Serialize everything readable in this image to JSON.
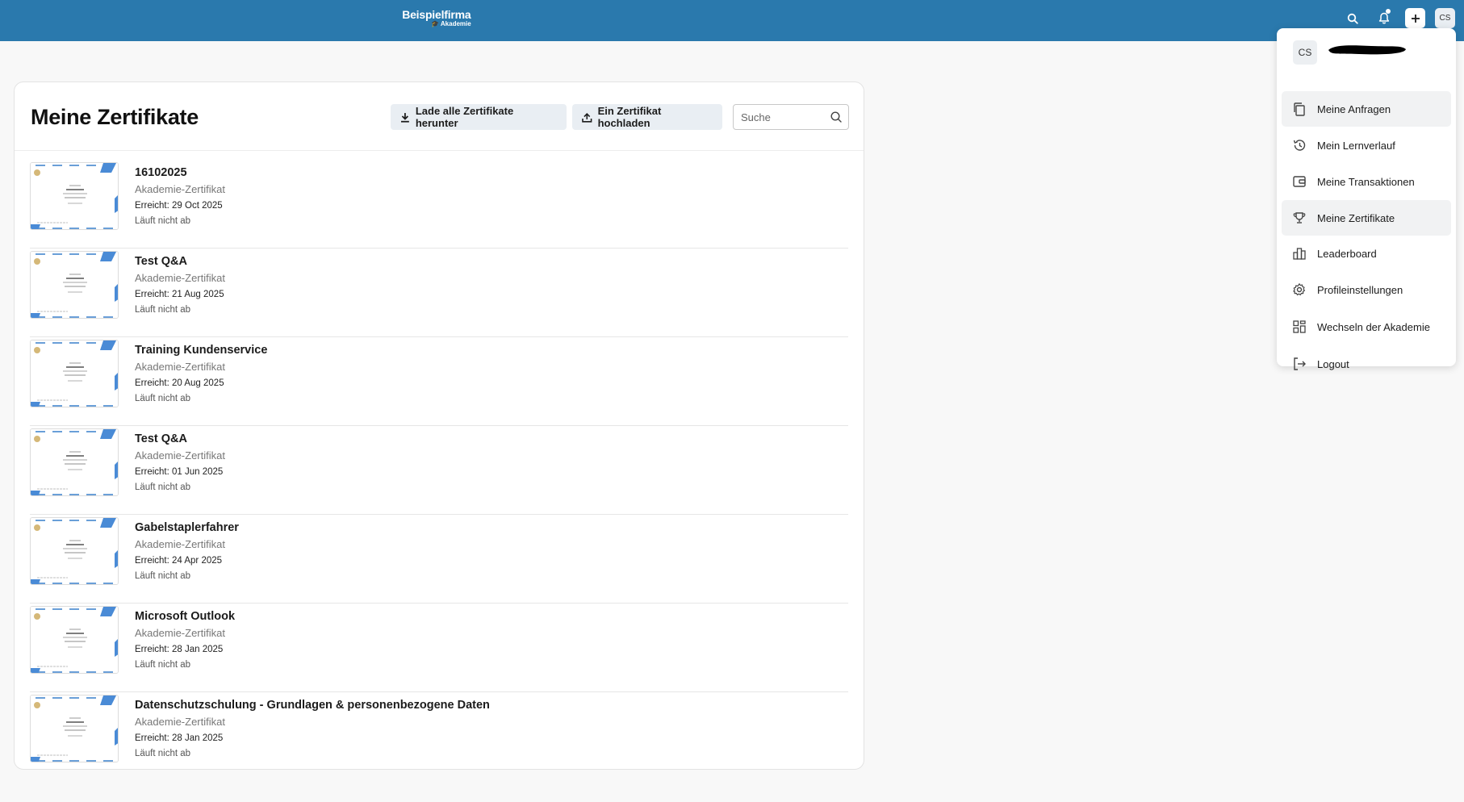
{
  "header": {
    "logo_line1": "Beispielfirma",
    "logo_line2": "Akademie",
    "avatar_initials": "CS",
    "colors": {
      "bar": "#2a79ad"
    }
  },
  "page": {
    "title": "Meine Zertifikate",
    "download_all_label": "Lade alle Zertifikate herunter",
    "upload_label": "Ein Zertifikat hochladen",
    "search_placeholder": "Suche",
    "search_value": ""
  },
  "certificates": [
    {
      "title": "16102025",
      "type": "Akademie-Zertifikat",
      "achieved": "Erreicht: 29 Oct 2025",
      "expiry": "Läuft nicht ab"
    },
    {
      "title": "Test Q&A",
      "type": "Akademie-Zertifikat",
      "achieved": "Erreicht: 21 Aug 2025",
      "expiry": "Läuft nicht ab"
    },
    {
      "title": "Training Kundenservice",
      "type": "Akademie-Zertifikat",
      "achieved": "Erreicht: 20 Aug 2025",
      "expiry": "Läuft nicht ab"
    },
    {
      "title": "Test Q&A",
      "type": "Akademie-Zertifikat",
      "achieved": "Erreicht: 01 Jun 2025",
      "expiry": "Läuft nicht ab"
    },
    {
      "title": "Gabelstaplerfahrer",
      "type": "Akademie-Zertifikat",
      "achieved": "Erreicht: 24 Apr 2025",
      "expiry": "Läuft nicht ab"
    },
    {
      "title": "Microsoft Outlook",
      "type": "Akademie-Zertifikat",
      "achieved": "Erreicht: 28 Jan 2025",
      "expiry": "Läuft nicht ab"
    },
    {
      "title": "Datenschutzschulung - Grundlagen & personenbezogene Daten",
      "type": "Akademie-Zertifikat",
      "achieved": "Erreicht: 28 Jan 2025",
      "expiry": "Läuft nicht ab"
    }
  ],
  "user_menu": {
    "avatar_initials": "CS",
    "items": [
      {
        "label": "Meine Anfragen",
        "icon": "copy-icon",
        "active": true
      },
      {
        "label": "Mein Lernverlauf",
        "icon": "history-icon",
        "active": false
      },
      {
        "label": "Meine Transaktionen",
        "icon": "wallet-icon",
        "active": false
      },
      {
        "label": "Meine Zertifikate",
        "icon": "trophy-icon",
        "active": true
      },
      {
        "label": "Leaderboard",
        "icon": "leaderboard-icon",
        "active": false
      },
      {
        "label": "Profileinstellungen",
        "icon": "gear-icon",
        "active": false
      },
      {
        "label": "Wechseln der Akademie",
        "icon": "grid-icon",
        "active": false
      },
      {
        "label": "Logout",
        "icon": "logout-icon",
        "active": false
      }
    ]
  }
}
